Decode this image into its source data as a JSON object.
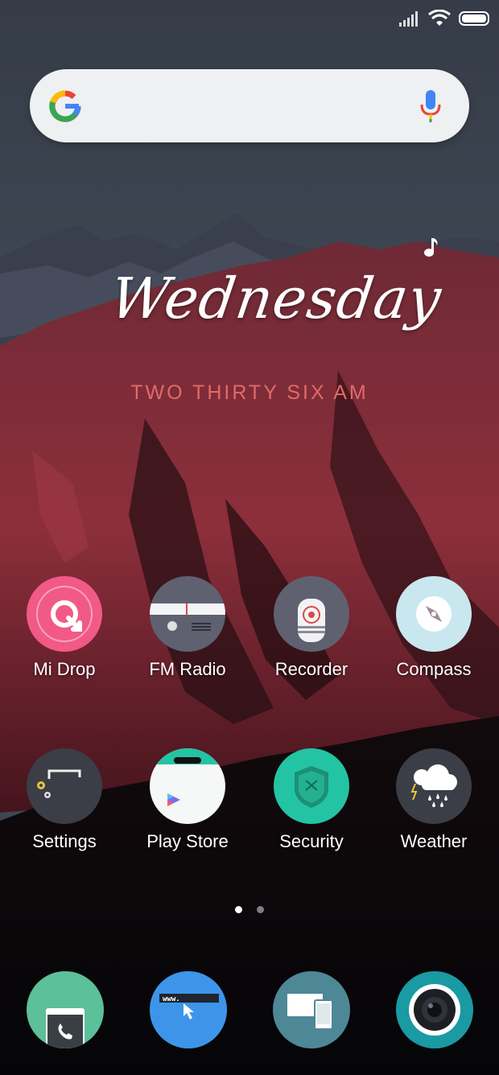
{
  "status": {
    "signal_icon": "signal-bars-icon",
    "wifi_icon": "wifi-icon",
    "battery_icon": "battery-icon"
  },
  "search": {
    "logo_icon": "google-g-icon",
    "mic_icon": "microphone-icon"
  },
  "widget": {
    "day": "Wednesday",
    "time": "TWO THIRTY SIX AM",
    "music_icon": "music-note-icon",
    "time_color": "#e26a68"
  },
  "apps": [
    {
      "label": "Mi Drop",
      "icon": "mi-drop-icon",
      "color": "#f15a86"
    },
    {
      "label": "FM Radio",
      "icon": "radio-icon",
      "color": "#5f6170"
    },
    {
      "label": "Recorder",
      "icon": "microphone-recorder-icon",
      "color": "#5f6170"
    },
    {
      "label": "Compass",
      "icon": "compass-icon",
      "color": "#c9e7ee"
    },
    {
      "label": "Settings",
      "icon": "gear-icon",
      "color": "#3b3e46"
    },
    {
      "label": "Play Store",
      "icon": "play-store-icon",
      "color": "#f6f7f7"
    },
    {
      "label": "Security",
      "icon": "shield-icon",
      "color": "#23c4a3"
    },
    {
      "label": "Weather",
      "icon": "weather-cloud-icon",
      "color": "#3b3e46"
    }
  ],
  "pages": {
    "count": 2,
    "active": 1
  },
  "dock": [
    {
      "icon": "phone-icon",
      "color": "#5cc09a"
    },
    {
      "icon": "browser-icon",
      "color": "#3d95ea",
      "url_text": "www."
    },
    {
      "icon": "screen-mirror-icon",
      "color": "#4e8796"
    },
    {
      "icon": "camera-icon",
      "color": "#1a9aa3"
    }
  ]
}
